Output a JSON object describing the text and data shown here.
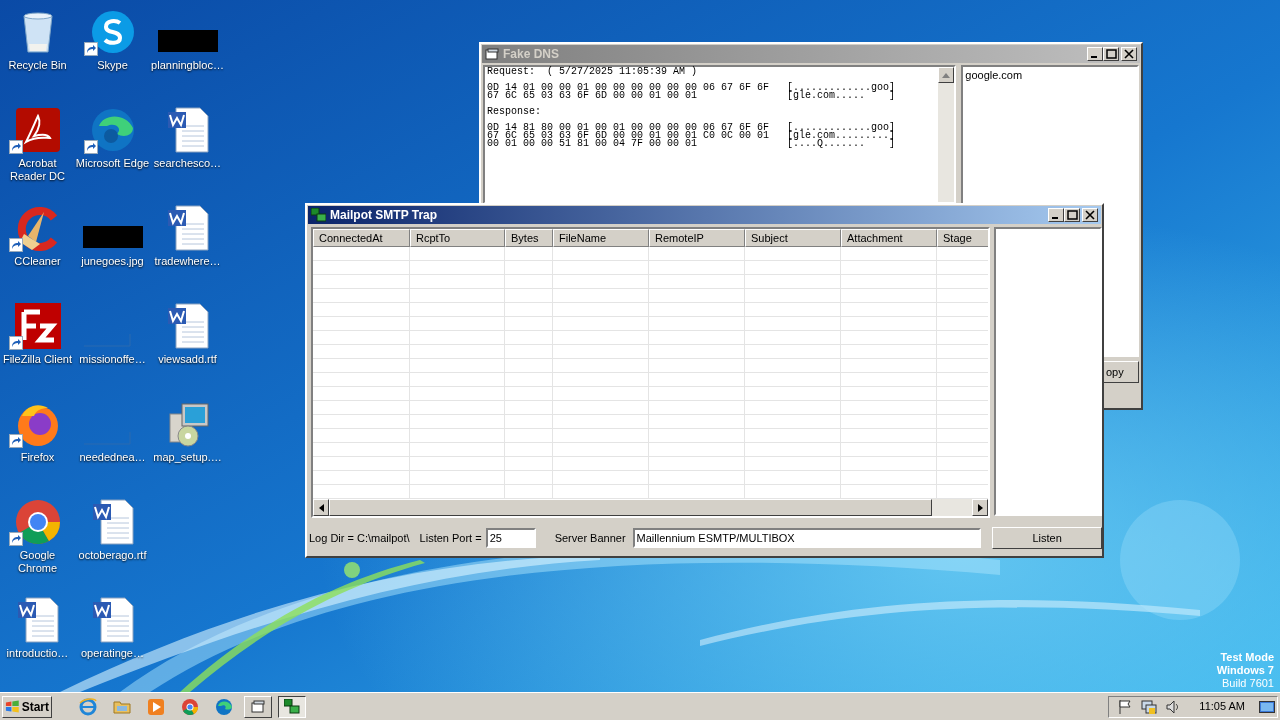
{
  "desktop_icons": [
    {
      "label": "Recycle Bin",
      "kind": "recycle",
      "shortcut": false
    },
    {
      "label": "Acrobat Reader DC",
      "kind": "acrobat",
      "shortcut": true
    },
    {
      "label": "CCleaner",
      "kind": "ccleaner",
      "shortcut": true
    },
    {
      "label": "FileZilla Client",
      "kind": "filezilla",
      "shortcut": true
    },
    {
      "label": "Firefox",
      "kind": "firefox",
      "shortcut": true
    },
    {
      "label": "Google Chrome",
      "kind": "chrome",
      "shortcut": true
    },
    {
      "label": "introductio…",
      "kind": "word",
      "shortcut": false
    },
    {
      "label": "Skype",
      "kind": "skype",
      "shortcut": true
    },
    {
      "label": "Microsoft Edge",
      "kind": "edge",
      "shortcut": true
    },
    {
      "label": "junegoes.jpg",
      "kind": "redacted",
      "shortcut": false
    },
    {
      "label": "missionoffe…",
      "kind": "blank",
      "shortcut": false
    },
    {
      "label": "needednea…",
      "kind": "blank",
      "shortcut": false
    },
    {
      "label": "octoberago.rtf",
      "kind": "word",
      "shortcut": false
    },
    {
      "label": "operatinge…",
      "kind": "word",
      "shortcut": false
    },
    {
      "label": "planningbloc…",
      "kind": "redacted",
      "shortcut": false
    },
    {
      "label": "searchesco…",
      "kind": "word",
      "shortcut": false
    },
    {
      "label": "tradewhere…",
      "kind": "word",
      "shortcut": false
    },
    {
      "label": "viewsadd.rtf",
      "kind": "word",
      "shortcut": false
    },
    {
      "label": "map_setup.…",
      "kind": "installer",
      "shortcut": false
    }
  ],
  "fake_dns": {
    "title": "Fake DNS",
    "log": [
      [
        "Request:  ( 5/27/2025 11:05:39 AM )"
      ],
      [
        "0D 14 01 00 00 01 00 00 00 00 00 00 06 67 6F 6F   [.............goo]",
        "67 6C 65 03 63 6F 6D 00 00 01 00 01               [gle.com.....    ]"
      ],
      [
        "Response:"
      ],
      [
        "0D 14 81 80 00 01 00 01 00 00 00 00 06 67 6F 6F   [.............goo]",
        "67 6C 65 03 63 6F 6D 00 00 01 00 01 C0 0C 00 01   [gle.com.........]",
        "00 01 00 00 51 81 00 04 7F 00 00 01               [....Q.......    ]"
      ]
    ],
    "domains": [
      "google.com"
    ],
    "button": "opy"
  },
  "mailpot": {
    "title": "Mailpot SMTP Trap",
    "columns": [
      "ConnectedAt",
      "RcptTo",
      "Bytes",
      "FileName",
      "RemoteIP",
      "Subject",
      "Attachment",
      "Stage"
    ],
    "log_dir": "Log Dir = C:\\mailpot\\",
    "port_label": "Listen Port =",
    "port": "25",
    "banner_label": "Server Banner",
    "banner": "Maillennium ESMTP/MULTIBOX",
    "button": "Listen"
  },
  "taskbar": {
    "start": "Start",
    "apps": [
      {
        "kind": "ie",
        "selected": false
      },
      {
        "kind": "explorer",
        "selected": false
      },
      {
        "kind": "media",
        "selected": false
      },
      {
        "kind": "chrome",
        "selected": false
      },
      {
        "kind": "edge",
        "selected": false
      },
      {
        "kind": "window-dns",
        "selected": false
      },
      {
        "kind": "window-mailpot",
        "selected": true
      }
    ],
    "tray": [
      {
        "kind": "flag"
      },
      {
        "kind": "network"
      },
      {
        "kind": "sound"
      }
    ],
    "clock": "11:05 AM"
  },
  "os_notice": [
    "Test Mode",
    "Windows 7",
    "Build 7601"
  ]
}
